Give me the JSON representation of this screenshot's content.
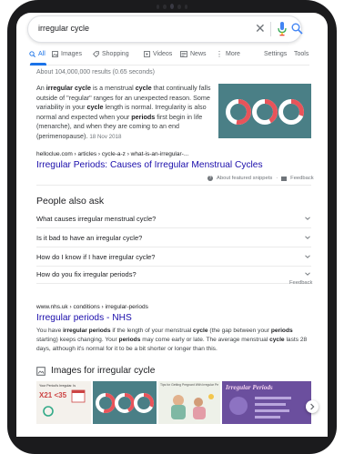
{
  "search": {
    "query": "irregular cycle"
  },
  "tabs": [
    {
      "label": "All",
      "icon": "search-icon"
    },
    {
      "label": "Images",
      "icon": "image-icon"
    },
    {
      "label": "Shopping",
      "icon": "tag-icon"
    },
    {
      "label": "Videos",
      "icon": "video-icon"
    },
    {
      "label": "News",
      "icon": "news-icon"
    },
    {
      "label": "More",
      "icon": "more-icon"
    },
    {
      "label": "Settings"
    },
    {
      "label": "Tools"
    }
  ],
  "results_count": "About 104,000,000 results (0.65 seconds)",
  "featured": {
    "snippet_parts": [
      {
        "t": "An ",
        "b": false
      },
      {
        "t": "irregular cycle",
        "b": true
      },
      {
        "t": " is a menstrual ",
        "b": false
      },
      {
        "t": "cycle",
        "b": true
      },
      {
        "t": " that continually falls outside of \"regular\" ranges for an unexpected reason. Some variability in your ",
        "b": false
      },
      {
        "t": "cycle",
        "b": true
      },
      {
        "t": " length is normal. Irregularity is also normal and expected when your ",
        "b": false
      },
      {
        "t": "periods",
        "b": true
      },
      {
        "t": " first begin in life (menarche), and when they are coming to an end (perimenopause).",
        "b": false
      }
    ],
    "date": "18 Nov 2018",
    "cite": "helloclue.com › articles › cycle-a-z › what-is-an-irregular-...",
    "title": "Irregular Periods: Causes of Irregular Menstrual Cycles",
    "about": "About featured snippets",
    "dot": "·",
    "feedback": "Feedback"
  },
  "paa": {
    "heading": "People also ask",
    "questions": [
      "What causes irregular menstrual cycle?",
      "Is it bad to have an irregular cycle?",
      "How do I know if I have irregular cycle?",
      "How do you fix irregular periods?"
    ],
    "feedback": "Feedback"
  },
  "result2": {
    "cite": "www.nhs.uk › conditions › irregular-periods",
    "title": "Irregular periods - NHS",
    "snippet_parts": [
      {
        "t": "You have ",
        "b": false
      },
      {
        "t": "irregular periods",
        "b": true
      },
      {
        "t": " if the length of your menstrual ",
        "b": false
      },
      {
        "t": "cycle",
        "b": true
      },
      {
        "t": " (the gap between your ",
        "b": false
      },
      {
        "t": "periods",
        "b": true
      },
      {
        "t": " starting) keeps changing. Your ",
        "b": false
      },
      {
        "t": "periods",
        "b": true
      },
      {
        "t": " may come early or late. The average menstrual ",
        "b": false
      },
      {
        "t": "cycle",
        "b": true
      },
      {
        "t": " lasts 28 days, although it's normal for it to be a bit shorter or longer than this.",
        "b": false
      }
    ]
  },
  "images": {
    "heading": "Images for irregular cycle",
    "thumb1_title": "Your Period's Irregular. Is",
    "thumb1_big": "X21  <35",
    "thumb3_title": "Tips for Getting Pregnant With Irregular Periods",
    "thumb4_title": "Irregular Periods"
  },
  "colors": {
    "link": "#1a0dab",
    "accent": "#1a73e8",
    "teal": "#4a7f86",
    "ring_red": "#e8545a",
    "purple": "#6b4f9e"
  }
}
